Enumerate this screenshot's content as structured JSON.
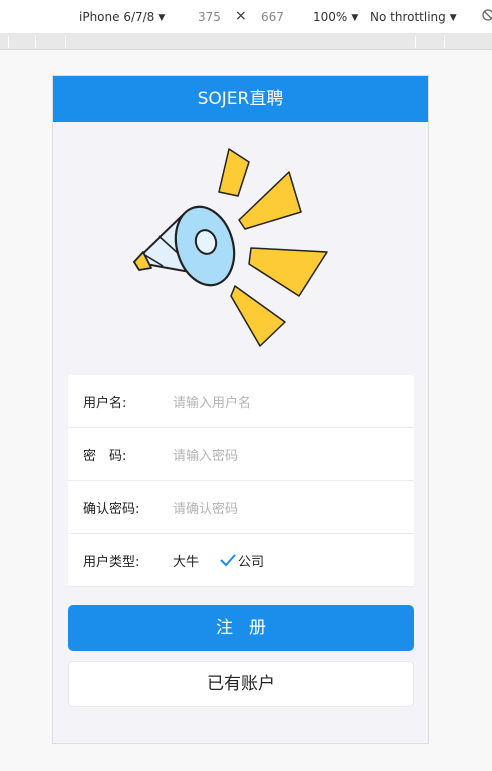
{
  "devtools": {
    "device": "iPhone 6/7/8",
    "width": "375",
    "times": "×",
    "height": "667",
    "zoom": "100%",
    "throttle": "No throttling"
  },
  "app": {
    "title": "SOJER直聘"
  },
  "form": {
    "username_label": "用户名:",
    "username_placeholder": "请输入用户名",
    "password_label": "密　码:",
    "password_placeholder": "请输入密码",
    "confirm_label": "确认密码:",
    "confirm_placeholder": "请确认密码",
    "type_label": "用户类型:",
    "type_options": [
      "大牛",
      "公司"
    ],
    "type_selected": "公司"
  },
  "actions": {
    "register": "注册",
    "login": "已有账户"
  },
  "colors": {
    "primary": "#1a8eea",
    "illustration_yellow": "#fccb35",
    "illustration_blue": "#a8dcf8"
  },
  "icons": [
    "megaphone-icon",
    "checkmark-icon",
    "dropdown-caret-icon",
    "lock-icon"
  ]
}
